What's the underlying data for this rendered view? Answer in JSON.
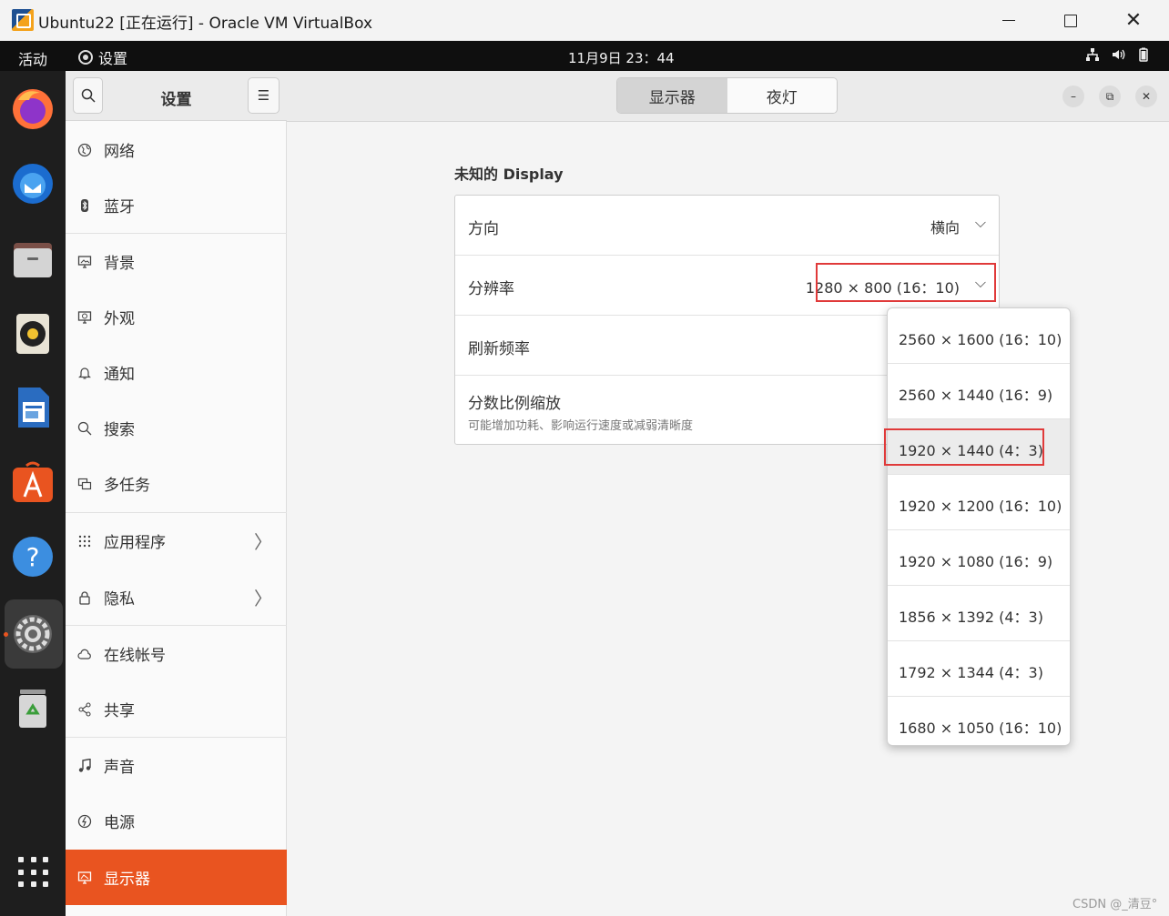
{
  "window": {
    "title": "Ubuntu22 [正在运行] - Oracle VM VirtualBox"
  },
  "topbar": {
    "activities": "活动",
    "app_name": "设置",
    "clock": "11月9日  23：44"
  },
  "dock": {
    "apps": [
      "firefox-icon",
      "thunderbird-icon",
      "files-icon",
      "rhythmbox-icon",
      "libreoffice-writer-icon",
      "app-center-icon",
      "help-icon",
      "settings-icon",
      "trash-icon"
    ],
    "active": "settings-icon"
  },
  "sidebar": {
    "title": "设置",
    "items": [
      {
        "label": "网络",
        "icon": "network-icon"
      },
      {
        "label": "蓝牙",
        "icon": "bluetooth-icon"
      },
      {
        "label": "背景",
        "icon": "background-icon"
      },
      {
        "label": "外观",
        "icon": "appearance-icon"
      },
      {
        "label": "通知",
        "icon": "bell-icon"
      },
      {
        "label": "搜索",
        "icon": "search-icon"
      },
      {
        "label": "多任务",
        "icon": "multitask-icon"
      },
      {
        "label": "应用程序",
        "icon": "apps-grid-icon"
      },
      {
        "label": "隐私",
        "icon": "lock-icon"
      },
      {
        "label": "在线帐号",
        "icon": "cloud-icon"
      },
      {
        "label": "共享",
        "icon": "share-icon"
      },
      {
        "label": "声音",
        "icon": "music-note-icon"
      },
      {
        "label": "电源",
        "icon": "power-icon"
      },
      {
        "label": "显示器",
        "icon": "display-icon"
      }
    ],
    "active": "显示器"
  },
  "header": {
    "tabs": [
      {
        "label": "显示器",
        "selected": true
      },
      {
        "label": "夜灯",
        "selected": false
      }
    ]
  },
  "main": {
    "display_title": "未知的 Display",
    "rows": [
      {
        "label": "方向",
        "value": "横向"
      },
      {
        "label": "分辨率",
        "value": "1280 × 800 (16：10)"
      },
      {
        "label": "刷新频率",
        "value": ""
      },
      {
        "label": "分数比例缩放",
        "sublabel": "可能增加功耗、影响运行速度或减弱清晰度"
      }
    ]
  },
  "dropdown": {
    "options": [
      "2560 × 1600 (16：10)",
      "2560 × 1440 (16：9)",
      "1920 × 1440 (4：3)",
      "1920 × 1200 (16：10)",
      "1920 × 1080 (16：9)",
      "1856 × 1392 (4：3)",
      "1792 × 1344 (4：3)",
      "1680 × 1050 (16：10)"
    ],
    "hovered": "1920 × 1440 (4：3)"
  },
  "colors": {
    "accent": "#e95420",
    "annotation": "#e03a3a"
  },
  "watermark": "CSDN @_清豆°"
}
